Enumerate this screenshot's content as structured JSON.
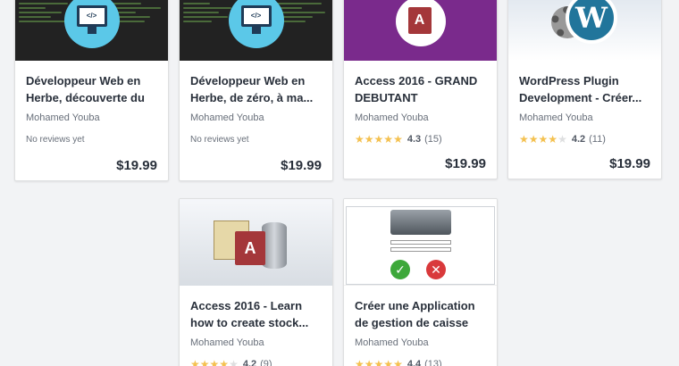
{
  "courses": [
    {
      "title": "Développeur Web en Herbe, découverte du CSS",
      "author": "Mohamed Youba",
      "reviews_text": "No reviews yet",
      "price": "$19.99",
      "thumbnail_icon": "code-monitor-icon"
    },
    {
      "title": "Développeur Web en Herbe, de zéro, à ma...",
      "author": "Mohamed Youba",
      "reviews_text": "No reviews yet",
      "price": "$19.99",
      "thumbnail_icon": "code-monitor-icon"
    },
    {
      "title": "Access 2016 - GRAND DEBUTANT",
      "author": "Mohamed Youba",
      "rating": "4.3",
      "rating_stars": 4.3,
      "rating_count": "(15)",
      "price": "$19.99",
      "thumbnail_icon": "access-logo-icon"
    },
    {
      "title": "WordPress Plugin Development - Créer...",
      "author": "Mohamed Youba",
      "rating": "4.2",
      "rating_stars": 4.2,
      "rating_count": "(11)",
      "price": "$19.99",
      "thumbnail_icon": "wordpress-gear-icon"
    },
    {
      "title": "Access 2016 - Learn how to create stock...",
      "author": "Mohamed Youba",
      "rating": "4.2",
      "rating_stars": 4.2,
      "rating_count": "(9)",
      "thumbnail_icon": "access-database-icon"
    },
    {
      "title": "Créer une Application de gestion de caisse avec...",
      "author": "Mohamed Youba",
      "rating": "4.4",
      "rating_stars": 4.4,
      "rating_count": "(13)",
      "thumbnail_icon": "cash-register-icon"
    }
  ],
  "colors": {
    "page_background": "#f2f3f5",
    "star": "#f4c150",
    "text": "#29303b"
  }
}
